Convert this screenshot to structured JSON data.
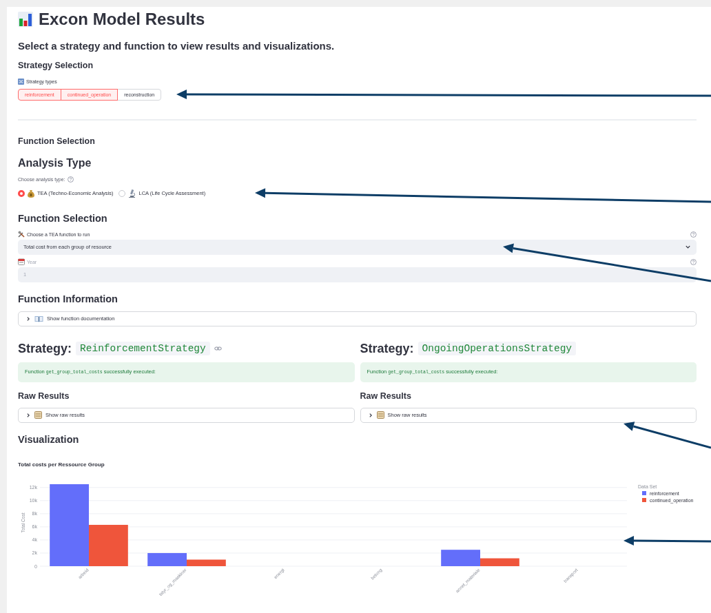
{
  "title": "Excon Model Results",
  "subtitle": "Select a strategy and function to view results and visualizations.",
  "strategy_selection": {
    "heading": "Strategy Selection",
    "label": "Strategy types",
    "pills": [
      {
        "label": "reinforcement",
        "selected": true
      },
      {
        "label": "continued_operation",
        "selected": true
      },
      {
        "label": "reconstruction",
        "selected": false
      }
    ]
  },
  "function_selection_heading": "Function Selection",
  "analysis_type": {
    "heading": "Analysis Type",
    "label": "Choose analysis type:",
    "options": [
      {
        "label": "TEA (Techno-Economic Analysis)",
        "kind": "money",
        "selected": true
      },
      {
        "label": "LCA (Life Cycle Assessment)",
        "kind": "microscope",
        "selected": false
      }
    ]
  },
  "function_selection": {
    "heading": "Function Selection",
    "select": {
      "label": "Choose a TEA function to run",
      "value": "Total cost from each group of resource"
    },
    "year": {
      "label": "Year",
      "value": "1",
      "disabled": true
    }
  },
  "function_information": {
    "heading": "Function Information",
    "expander": {
      "label": "Show function documentation",
      "expanded": false
    }
  },
  "strategies": [
    {
      "heading": "Strategy:",
      "name": "ReinforcementStrategy",
      "anchor_link": true,
      "message_prefix": "Function",
      "message_code": "get_group_total_costs",
      "message_suffix": "successfully executed:",
      "raw_heading": "Raw Results",
      "raw_expander": {
        "label": "Show raw results",
        "expanded": false
      }
    },
    {
      "heading": "Strategy:",
      "name": "OngoingOperationsStrategy",
      "anchor_link": false,
      "message_prefix": "Function",
      "message_code": "get_group_total_costs",
      "message_suffix": "successfully executed:",
      "raw_heading": "Raw Results",
      "raw_expander": {
        "label": "Show raw results",
        "expanded": false
      }
    }
  ],
  "visualization": {
    "heading": "Visualization",
    "chart_data": {
      "type": "bar",
      "title": "Total costs per Ressource Group",
      "ylabel": "Total Cost",
      "grid": true,
      "legend": {
        "title": "Data Set"
      },
      "categories": [
        "arbeid",
        "tstyr_og_maskiner",
        "energi",
        "betong",
        "annet_materiale",
        "transport"
      ],
      "series": [
        {
          "name": "reinforcement",
          "color": "#636efa",
          "values": [
            12500,
            2000,
            0,
            0,
            2500,
            0
          ]
        },
        {
          "name": "continued_operation",
          "color": "#ef553b",
          "values": [
            6300,
            1000,
            0,
            0,
            1200,
            0
          ]
        }
      ],
      "ylim": [
        0,
        12500
      ],
      "yticks": [
        {
          "value": 0,
          "label": "0"
        },
        {
          "value": 2000,
          "label": "2k"
        },
        {
          "value": 4000,
          "label": "4k"
        },
        {
          "value": 6000,
          "label": "6k"
        },
        {
          "value": 8000,
          "label": "8k"
        },
        {
          "value": 10000,
          "label": "10k"
        },
        {
          "value": 12000,
          "label": "12k"
        }
      ]
    }
  }
}
